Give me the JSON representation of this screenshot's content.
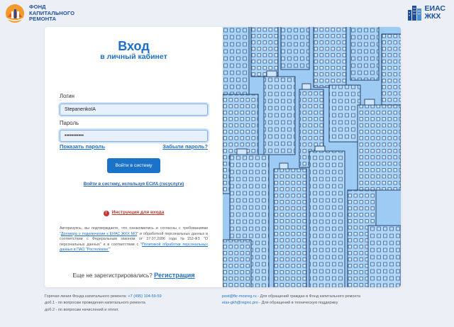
{
  "header": {
    "fund_logo_lines": [
      "ФОНД",
      "КАПИТАЛЬНОГО",
      "РЕМОНТА"
    ],
    "eias_logo_lines": [
      "ЕИАС",
      "ЖКХ"
    ]
  },
  "login": {
    "title": "Вход",
    "subtitle": "в личный кабинет",
    "login_label": "Логин",
    "login_value": "StepanenkoIA",
    "password_label": "Пароль",
    "password_value": "•••••••••••",
    "show_password": "Показать пароль",
    "forgot_password": "Забыли пароль?",
    "login_button": "Войти в систему",
    "esia_link": "Войти в систему, используя ЕСИА (госуслуги)",
    "instructions": "Инструкция для входа",
    "consent_part1": "Авторизуясь, вы подтверждаете, что ознакомились и согласны с требованиями \"",
    "consent_link1": "Договора о подключении к ЕИАС ЖКХ МО",
    "consent_part2": "\" и обработкой персональных данных в соответствии с Федеральным законом от 27.07.2006 года №152-ФЗ \"О персональных данных\" и в соответствии с \"",
    "consent_link2": "Политикой обработки персональных данных в ПАО \"Ростелеком\"",
    "consent_part3": "\"",
    "register_prompt": "Еще не зарегистрировались?",
    "register_link": "Регистрация"
  },
  "footer": {
    "hotline_label": "Горячая линия Фонда капитального ремонта: ",
    "hotline_phone": "+7 (495) 104-59-59",
    "ext1": "доб.1 - по вопросам проведения капитального ремонта.",
    "ext2": "доб.2 - по вопросам начислений и оплат.",
    "email1": "post@fkr-mosreg.ru",
    "email1_desc": " - Для обращений граждан в Фонд капитального ремонта",
    "email2": "eias-gkh@reginc.pro",
    "email2_desc": " - Для обращений в техническую поддержку"
  },
  "colors": {
    "accent": "#1a73c8",
    "art_background": "#9dcbf3",
    "page_background": "#ecf0f6"
  }
}
